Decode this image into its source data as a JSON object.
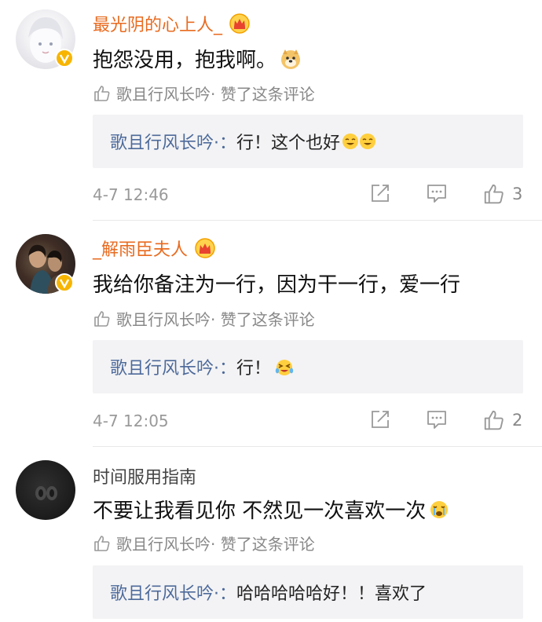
{
  "comments": [
    {
      "nickname": "最光阴的心上人_",
      "text": "抱怨没用，抱我啊。",
      "emoji_icon": "doge-emoji",
      "liked_by": "歌且行风长吟· 赞了这条评论",
      "reply": {
        "author": "歌且行风长吟·",
        "sep": "：",
        "text": "行！这个也好"
      },
      "time": "4-7 12:46",
      "likes": "3"
    },
    {
      "nickname": "_解雨臣夫人",
      "text": "我给你备注为一行，因为干一行，爱一行",
      "liked_by": "歌且行风长吟· 赞了这条评论",
      "reply": {
        "author": "歌且行风长吟·",
        "sep": "：",
        "text": "行！"
      },
      "time": "4-7 12:05",
      "likes": "2"
    },
    {
      "nickname": "时间服用指南",
      "text": "不要让我看见你 不然见一次喜欢一次",
      "liked_by": "歌且行风长吟· 赞了这条评论",
      "reply": {
        "author": "歌且行风长吟·",
        "sep": "：",
        "text": "哈哈哈哈哈好！！喜欢了"
      }
    }
  ],
  "colors": {
    "nickname_vip": "#e86b20",
    "reply_author": "#4d6a9a",
    "reply_bg": "#f3f3f5",
    "badge": "#f7b500"
  }
}
